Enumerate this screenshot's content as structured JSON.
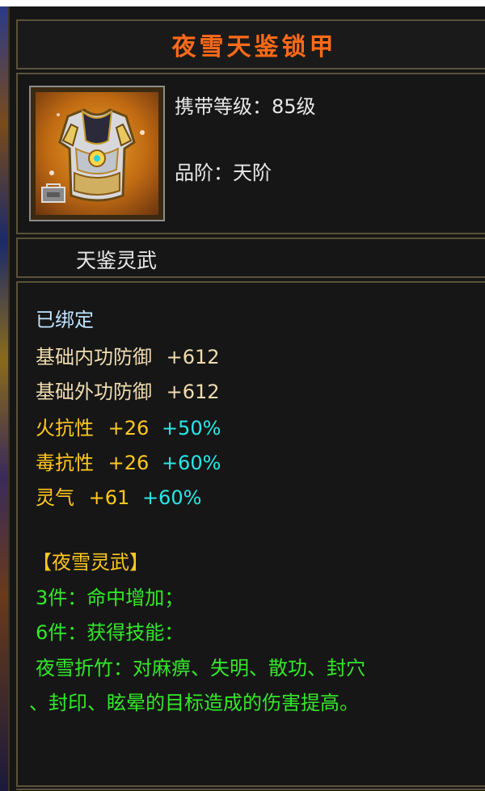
{
  "item": {
    "name": "夜雪天鉴锁甲",
    "carry_level_label": "携带等级：85级",
    "grade_label": "品阶：天阶",
    "set_name": "天鉴灵武"
  },
  "stats": {
    "bound": "已绑定",
    "base_inner_def_label": "基础内功防御",
    "base_inner_def_value": "+612",
    "base_outer_def_label": "基础外功防御",
    "base_outer_def_value": "+612",
    "fire_res_label": "火抗性",
    "fire_res_value": "+26",
    "fire_res_bonus": "+50%",
    "poison_res_label": "毒抗性",
    "poison_res_value": "+26",
    "poison_res_bonus": "+60%",
    "spirit_label": "灵气",
    "spirit_value": "+61",
    "spirit_bonus": "+60%"
  },
  "set_bonus": {
    "title": "【夜雪灵武】",
    "piece3": "3件：命中增加；",
    "piece6": "6件：获得技能：",
    "skill_line1": "夜雪折竹：对麻痹、失明、散功、封穴",
    "skill_line2": "、封印、眩晕的目标造成的伤害提高。"
  },
  "colors": {
    "title": "#ff6a18",
    "bound": "#bfe4ff",
    "base_stat": "#f0dcb0",
    "gold_stat": "#ffc81e",
    "percent_bonus": "#28e8e8",
    "set_text": "#34e82a"
  },
  "icons": {
    "item_icon": "armor-vest-icon",
    "badge_icon": "armor-type-badge-icon"
  }
}
